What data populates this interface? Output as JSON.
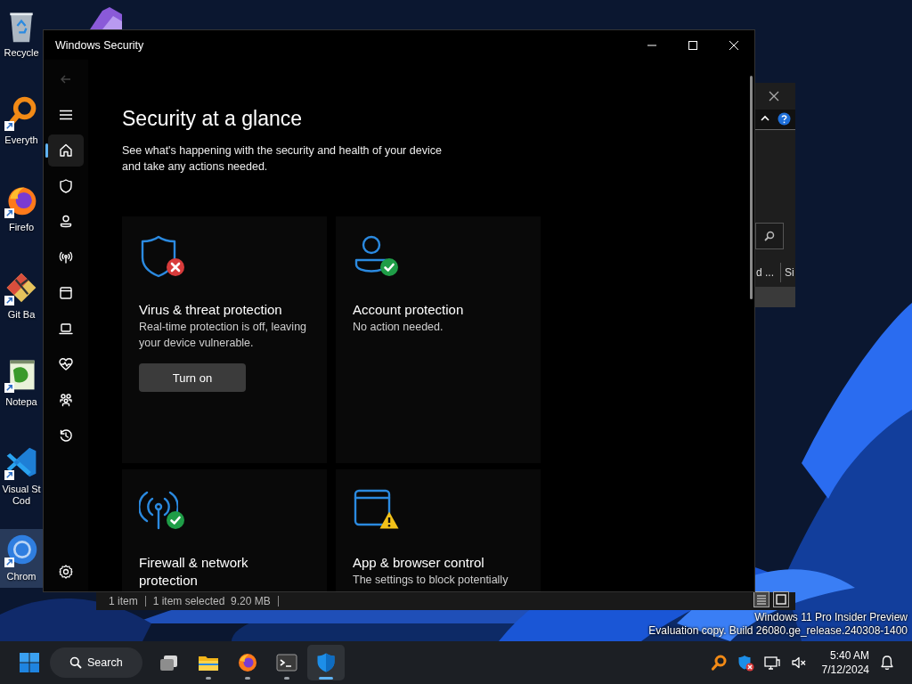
{
  "desktop": {
    "icons": [
      {
        "kind": "recycle",
        "label": "Recycle",
        "shortcut": false,
        "selected": false
      },
      {
        "kind": "everything",
        "label": "Everyth",
        "shortcut": true,
        "selected": false
      },
      {
        "kind": "firefox",
        "label": "Firefo",
        "shortcut": true,
        "selected": false
      },
      {
        "kind": "git",
        "label": "Git Ba",
        "shortcut": true,
        "selected": false
      },
      {
        "kind": "notepad",
        "label": "Notepa",
        "shortcut": true,
        "selected": false
      },
      {
        "kind": "vscode",
        "label": "Visual St Cod",
        "shortcut": true,
        "selected": false
      },
      {
        "kind": "chrome",
        "label": "Chrom",
        "shortcut": true,
        "selected": true
      }
    ],
    "watermark": [
      "Windows 11 Pro Insider Preview",
      "Evaluation copy. Build 26080.ge_release.240308-1400"
    ]
  },
  "background_window": {
    "column_fragments": [
      "d ...",
      "Si"
    ],
    "status_bar": [
      "1 item",
      "1 item selected  9.20 MB"
    ]
  },
  "window": {
    "title": "Windows Security",
    "back_disabled": true,
    "nav": [
      {
        "kind": "home",
        "selected": true
      },
      {
        "kind": "shield",
        "selected": false
      },
      {
        "kind": "account",
        "selected": false
      },
      {
        "kind": "network",
        "selected": false
      },
      {
        "kind": "browser",
        "selected": false
      },
      {
        "kind": "device",
        "selected": false
      },
      {
        "kind": "health",
        "selected": false
      },
      {
        "kind": "family",
        "selected": false
      },
      {
        "kind": "history",
        "selected": false
      }
    ],
    "heading": "Security at a glance",
    "subtitle": "See what's happening with the security and health of your device and take any actions needed.",
    "cards": [
      {
        "kind": "shield",
        "badge": {
          "kind": "error"
        },
        "title": "Virus & threat protection",
        "description": "Real-time protection is off, leaving your device vulnerable.",
        "button": "Turn on"
      },
      {
        "kind": "account",
        "badge": {
          "kind": "ok"
        },
        "title": "Account protection",
        "description": "No action needed."
      },
      {
        "kind": "network",
        "badge": {
          "kind": "ok"
        },
        "title": "Firewall & network protection"
      },
      {
        "kind": "browser",
        "badge": {
          "kind": "warning"
        },
        "title": "App & browser control",
        "description": "The settings to block potentially"
      }
    ]
  },
  "taskbar": {
    "search": "Search",
    "apps": [
      {
        "kind": "taskview",
        "running": false,
        "selected": false
      },
      {
        "kind": "explorer",
        "running": true,
        "selected": false
      },
      {
        "kind": "firefox",
        "running": true,
        "selected": false
      },
      {
        "kind": "terminal",
        "running": true,
        "selected": false
      },
      {
        "kind": "security",
        "running": true,
        "selected": true
      }
    ],
    "clock": {
      "time": "5:40 AM",
      "date": "7/12/2024"
    }
  }
}
